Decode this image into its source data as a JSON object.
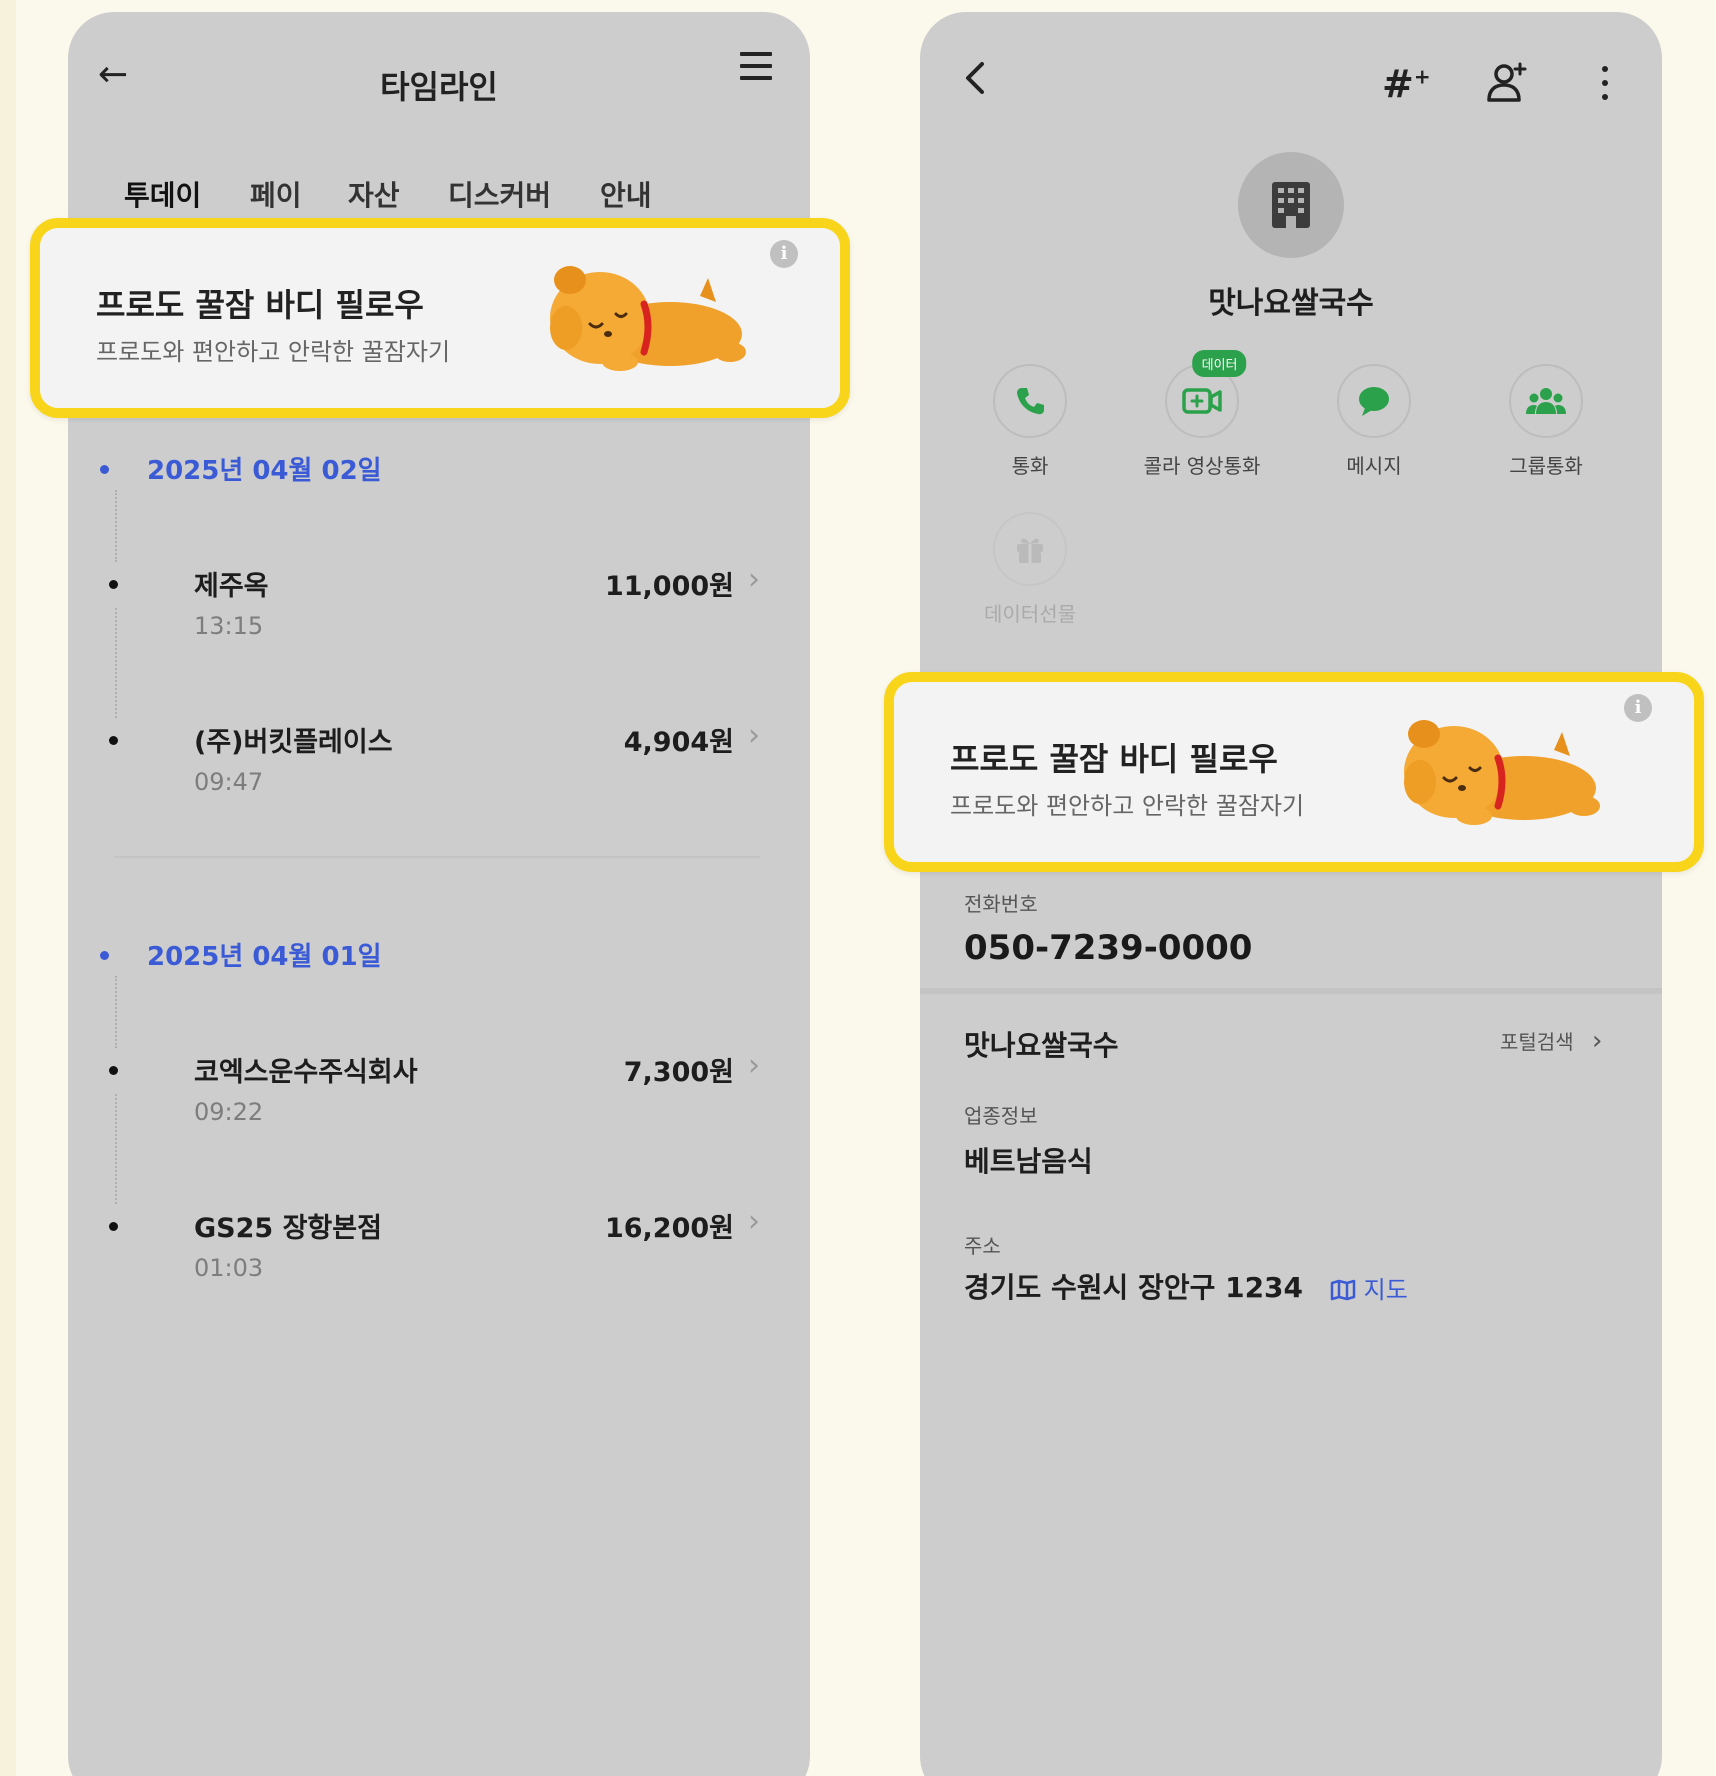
{
  "timeline": {
    "title": "타임라인",
    "tabs": [
      "투데이",
      "페이",
      "자산",
      "디스커버",
      "안내"
    ],
    "groups": [
      {
        "date": "2025년 04월 02일",
        "items": [
          {
            "name": "제주옥",
            "time": "13:15",
            "amount": "11,000원"
          },
          {
            "name": "(주)버킷플레이스",
            "time": "09:47",
            "amount": "4,904원"
          }
        ]
      },
      {
        "date": "2025년 04월 01일",
        "items": [
          {
            "name": "코엑스운수주식회사",
            "time": "09:22",
            "amount": "7,300원"
          },
          {
            "name": "GS25 장항본점",
            "time": "01:03",
            "amount": "16,200원"
          }
        ]
      }
    ]
  },
  "ad": {
    "title": "프로도 꿀잠 바디 필로우",
    "subtitle": "프로도와 편안하고 안락한 꿀잠자기",
    "info_icon": "i",
    "highlight_color": "#f8d51a"
  },
  "profile": {
    "name": "맛나요쌀국수",
    "actions": [
      {
        "label": "통화",
        "icon": "phone-icon"
      },
      {
        "label": "콜라 영상통화",
        "icon": "video-call-icon",
        "badge": "데이터"
      },
      {
        "label": "메시지",
        "icon": "message-icon"
      },
      {
        "label": "그룹통화",
        "icon": "group-call-icon"
      },
      {
        "label": "데이터선물",
        "icon": "gift-icon",
        "disabled": true
      }
    ],
    "accent_color": "#2aa14a",
    "phone_label": "전화번호",
    "phone_number": "050-7239-0000",
    "business_name": "맛나요쌀국수",
    "portal_search": "포털검색",
    "category_label": "업종정보",
    "category_value": "베트남음식",
    "address_label": "주소",
    "address_value": "경기도 수원시 장안구 1234",
    "map_label": "지도"
  }
}
